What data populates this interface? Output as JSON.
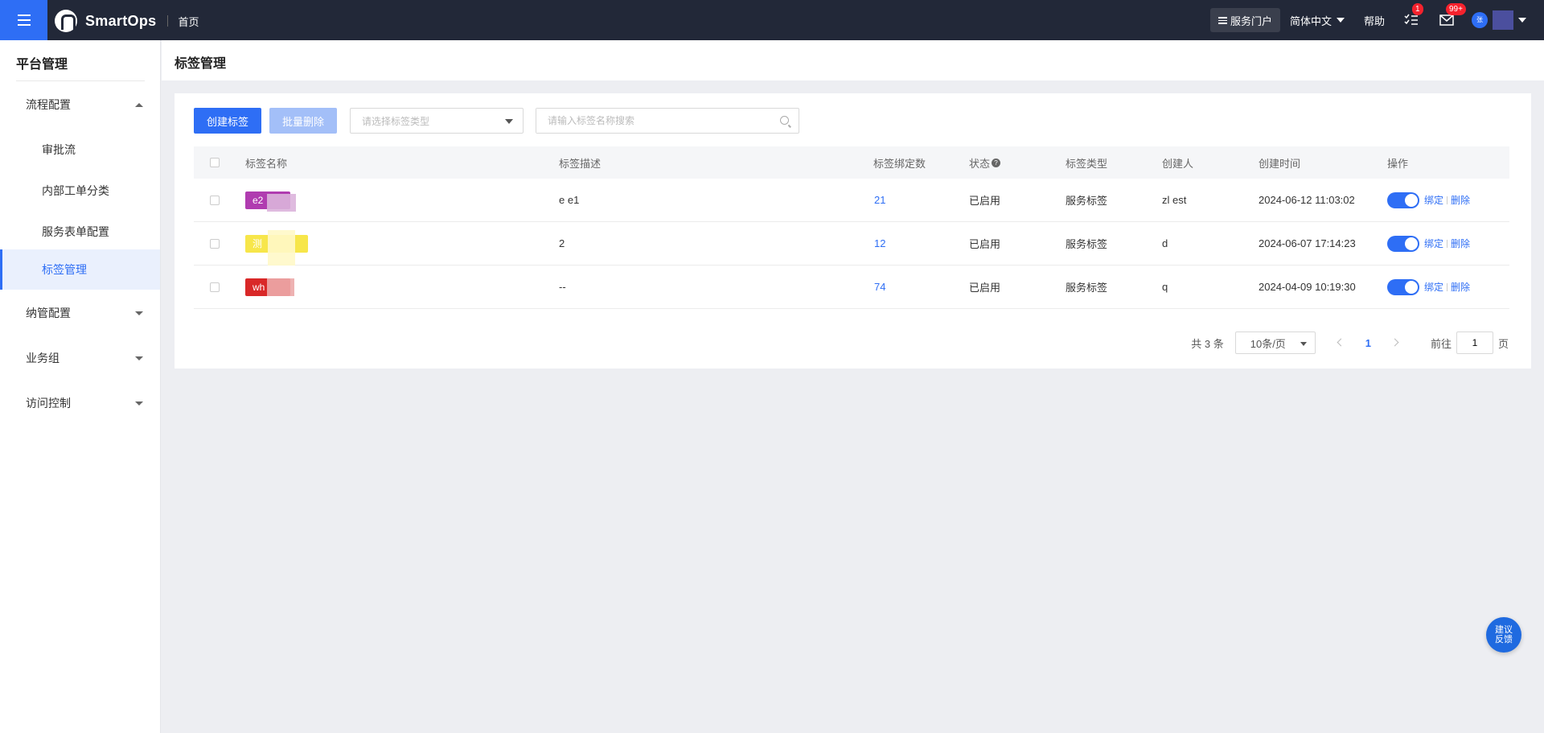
{
  "topbar": {
    "app_name": "SmartOps",
    "home_link": "首页",
    "portal_label": "服务门户",
    "language": "简体中文",
    "help": "帮助",
    "task_badge": "1",
    "message_badge": "99+",
    "avatar_text": "张"
  },
  "sidebar": {
    "title": "平台管理",
    "items": [
      {
        "label": "流程配置",
        "kind": "group",
        "expanded": true
      },
      {
        "label": "审批流",
        "kind": "sub"
      },
      {
        "label": "内部工单分类",
        "kind": "sub"
      },
      {
        "label": "服务表单配置",
        "kind": "sub"
      },
      {
        "label": "标签管理",
        "kind": "sub",
        "active": true
      },
      {
        "label": "纳管配置",
        "kind": "group",
        "expanded": false
      },
      {
        "label": "业务组",
        "kind": "group",
        "expanded": false
      },
      {
        "label": "访问控制",
        "kind": "group",
        "expanded": false
      }
    ]
  },
  "page": {
    "title": "标签管理",
    "create_button": "创建标签",
    "batch_delete_button": "批量删除",
    "type_select_placeholder": "请选择标签类型",
    "search_placeholder": "请输入标签名称搜索"
  },
  "table": {
    "columns": [
      "标签名称",
      "标签描述",
      "标签绑定数",
      "状态",
      "标签类型",
      "创建人",
      "创建时间",
      "操作"
    ],
    "rows": [
      {
        "name": "e2",
        "color": "#b03cb0",
        "description": "e      e1",
        "count": "21",
        "status": "已启用",
        "type": "服务标签",
        "creator": "zl        est",
        "created": "2024-06-12 11:03:02"
      },
      {
        "name": "测",
        "color": "#f7e64a",
        "description": "2",
        "count": "12",
        "status": "已启用",
        "type": "服务标签",
        "creator": "d",
        "created": "2024-06-07 17:14:23"
      },
      {
        "name": "wh",
        "color": "#d92828",
        "description": "--",
        "count": "74",
        "status": "已启用",
        "type": "服务标签",
        "creator": "q",
        "created": "2024-04-09 10:19:30"
      }
    ],
    "op_bind": "绑定",
    "op_delete": "删除"
  },
  "pagination": {
    "total": "共 3 条",
    "page_size": "10条/页",
    "current": "1",
    "goto_prefix": "前往",
    "goto_value": "1",
    "goto_suffix": "页"
  },
  "feedback": "建议反馈",
  "colors": {
    "primary": "#2e6ef5",
    "topbar": "#222838"
  }
}
